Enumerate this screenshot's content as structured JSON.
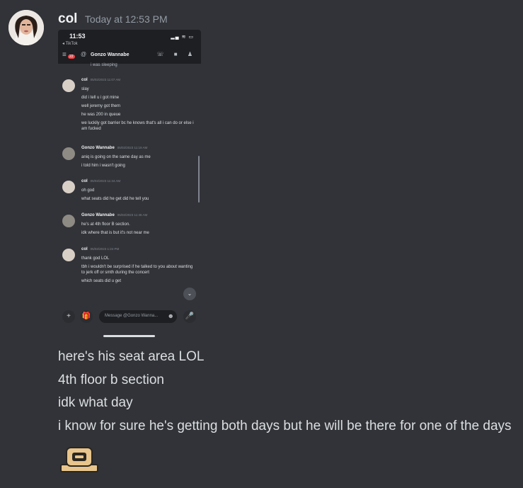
{
  "message": {
    "username": "col",
    "timestamp": "Today at 12:53 PM",
    "lines": [
      "here's his seat area LOL",
      "4th floor b section",
      "idk what day",
      "i know for sure he's getting both days but he will be there for one of the days"
    ]
  },
  "screenshot": {
    "status_time": "11:53",
    "back_app": "◂ TikTok",
    "status_icons": "▂▄ ≋ ▭",
    "channel": {
      "unread_count": "22",
      "name": "Gonzo Wannabe",
      "at_symbol": "@",
      "menu_icon": "≡",
      "actions": "☏ ■ ♟"
    },
    "prev_line": "i was sleeping",
    "messages": [
      {
        "author": "col",
        "time": "05/02/2023 11:07 AM",
        "lines": [
          "slay",
          "did i tell u i got mine",
          "well jeremy got them",
          "he was 200 in queue",
          "we luckily got barrier bc he knows that's all i can do or else i am fucked"
        ]
      },
      {
        "author": "Gonzo Wannabe",
        "time": "05/02/2023 11:19 AM",
        "lines": [
          "aniq is going on the same day as me",
          "i told him i wasn't going"
        ]
      },
      {
        "author": "col",
        "time": "05/02/2023 11:34 AM",
        "lines": [
          "oh god",
          "what seats did he get did he tell you"
        ]
      },
      {
        "author": "Gonzo Wannabe",
        "time": "05/02/2023 11:46 AM",
        "lines": [
          "he's at 4th floor B section.",
          "idk where that is but it's not near me"
        ]
      },
      {
        "author": "col",
        "time": "05/02/2023 1:24 PM",
        "lines": [
          "thank god LOL",
          "tbh i wouldn't be surprised if he talked to you about wanting to jerk off or smth during the concert",
          "which seats did u get"
        ]
      }
    ],
    "composer": {
      "plus": "+",
      "gift": "🎁",
      "placeholder": "Message @Gonzo Wanna...",
      "emoji": "☻",
      "mic": "🎤"
    },
    "jump_icon": "⌄"
  },
  "icons": {
    "avatar": "user-avatar",
    "emoji_sticker": "robot-face-emoji"
  },
  "colors": {
    "background": "#313338",
    "username": "#f2f3f5",
    "timestamp": "#949ba4",
    "text": "#dbdee1",
    "emoji": "#e8c58c"
  }
}
